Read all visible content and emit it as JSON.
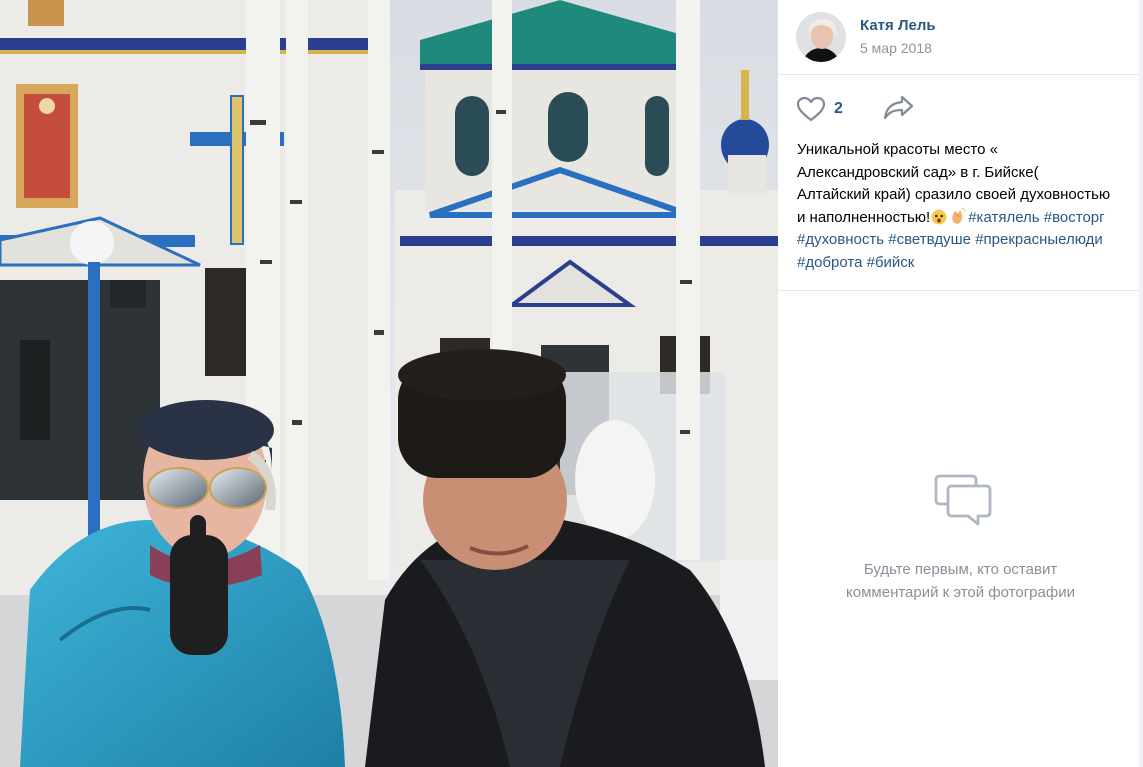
{
  "author": {
    "name": "Катя Лель",
    "date": "5 мар 2018"
  },
  "likes": {
    "count": "2",
    "icon": "heart-icon"
  },
  "share": {
    "icon": "share-arrow-icon"
  },
  "caption": {
    "line1": "Уникальной красоты место «",
    "line2": "Александровский сад» в г. Бийске(",
    "line3": "Алтайский край) сразило своей духовностью",
    "line4_text": "и наполненностью!",
    "line4_emojis": [
      "shocked-face-emoji",
      "clapping-hands-emoji"
    ],
    "hashtags": [
      "#катялель",
      "#восторг",
      "#духовность",
      "#светвдуше",
      "#прекрасныелюди",
      "#доброта",
      "#бийск"
    ]
  },
  "comments": {
    "icon": "comments-icon",
    "empty_line1": "Будьте первым, кто оставит",
    "empty_line2": "комментарий к этой фотографии"
  },
  "colors": {
    "link": "#2a5885",
    "muted": "#939393",
    "divider": "#e7e8ec"
  }
}
